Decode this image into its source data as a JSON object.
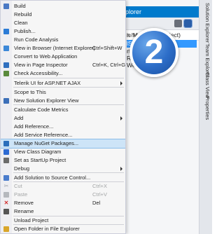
{
  "menu": {
    "items": [
      {
        "label": "Build",
        "shortcut": "",
        "icon": "build-icon",
        "color": "#4a79c4"
      },
      {
        "label": "Rebuild",
        "shortcut": "",
        "icon": "",
        "color": ""
      },
      {
        "label": "Clean",
        "shortcut": "",
        "icon": "",
        "color": ""
      },
      {
        "label": "Publish...",
        "shortcut": "",
        "icon": "publish-icon",
        "color": "#2b7bd6"
      },
      {
        "label": "Run Code Analysis",
        "shortcut": "",
        "icon": "",
        "color": ""
      },
      {
        "label": "View in Browser (Internet Explorer)",
        "shortcut": "Ctrl+Shift+W",
        "icon": "browser-icon",
        "color": "#3b87d8"
      },
      {
        "label": "Convert to Web Application",
        "shortcut": "",
        "icon": "",
        "color": ""
      },
      {
        "label": "View in Page Inspector",
        "shortcut": "Ctrl+K, Ctrl+G",
        "icon": "page-inspector-icon",
        "color": "#2f6fbf"
      },
      {
        "label": "Check Accessibility...",
        "shortcut": "",
        "icon": "accessibility-icon",
        "color": "#5a8a3c"
      },
      {
        "label": "Telerik UI for ASP.NET AJAX",
        "shortcut": "",
        "icon": "",
        "color": "",
        "submenu": true
      },
      {
        "label": "Scope to This",
        "shortcut": "",
        "icon": "",
        "color": ""
      },
      {
        "label": "New Solution Explorer View",
        "shortcut": "",
        "icon": "solution-explorer-icon",
        "color": "#3c6fb8"
      },
      {
        "label": "Calculate Code Metrics",
        "shortcut": "",
        "icon": "",
        "color": ""
      },
      {
        "label": "Add",
        "shortcut": "",
        "icon": "",
        "color": "",
        "submenu": true
      },
      {
        "label": "Add Reference...",
        "shortcut": "",
        "icon": "",
        "color": ""
      },
      {
        "label": "Add Service Reference...",
        "shortcut": "",
        "icon": "",
        "color": ""
      },
      {
        "label": "Manage NuGet Packages...",
        "shortcut": "",
        "icon": "nuget-icon",
        "color": "#2a6ebb",
        "highlighted": true
      },
      {
        "label": "View Class Diagram",
        "shortcut": "",
        "icon": "class-diagram-icon",
        "color": "#2d6ad3"
      },
      {
        "label": "Set as StartUp Project",
        "shortcut": "",
        "icon": "gear-icon",
        "color": "#6b6b6b"
      },
      {
        "label": "Debug",
        "shortcut": "",
        "icon": "",
        "color": "",
        "submenu": true
      },
      {
        "label": "Add Solution to Source Control...",
        "shortcut": "",
        "icon": "source-control-icon",
        "color": "#4a7ccc"
      },
      {
        "label": "Cut",
        "shortcut": "Ctrl+X",
        "icon": "cut-icon",
        "color": "#9aa0a8",
        "disabled": true
      },
      {
        "label": "Paste",
        "shortcut": "Ctrl+V",
        "icon": "paste-icon",
        "color": "#b5b8bd",
        "disabled": true
      },
      {
        "label": "Remove",
        "shortcut": "Del",
        "icon": "remove-icon",
        "color": "#d23030"
      },
      {
        "label": "Rename",
        "shortcut": "",
        "icon": "rename-icon",
        "color": "#555555"
      },
      {
        "label": "Unload Project",
        "shortcut": "",
        "icon": "",
        "color": ""
      },
      {
        "label": "Open Folder in File Explorer",
        "shortcut": "",
        "icon": "folder-icon",
        "color": "#d9a62b"
      },
      {
        "label": "Properties",
        "shortcut": "Alt+Enter",
        "icon": "wrench-icon",
        "color": "#6b6b6b"
      }
    ]
  },
  "solution_explorer": {
    "title": "plorer",
    "search_placeholder": "lorer (Ctrl+;)",
    "rows": [
      "n 'MySite' (1 project)",
      "lSite",
      "rtes",
      "Refe",
      "Web"
    ]
  },
  "side_tabs": [
    "Solution Explorer",
    "Team Explorer",
    "Class View",
    "Properties"
  ],
  "badge": {
    "number": "2"
  },
  "colors": {
    "accent": "#007acc",
    "selection": "#3399ff",
    "highlight": "#cde4f7",
    "badge": "#2c6dc8"
  }
}
